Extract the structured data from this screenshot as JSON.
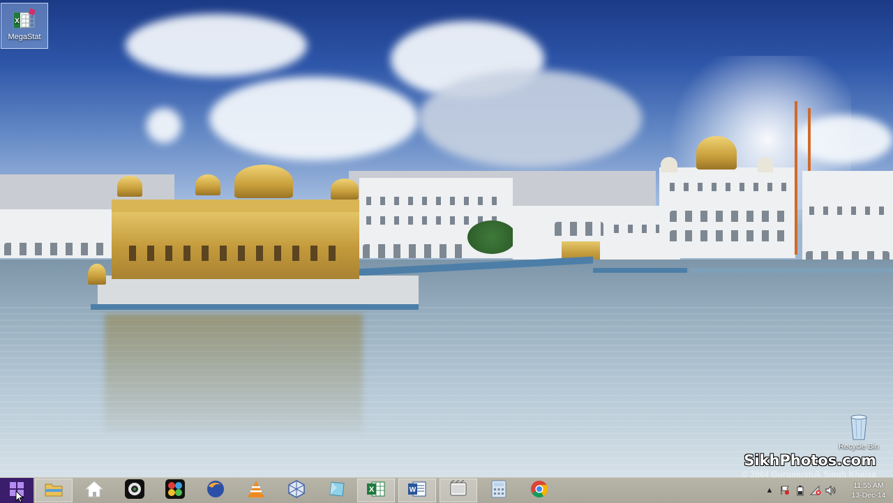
{
  "desktop": {
    "icons": [
      {
        "label": "MegaStat",
        "icon": "excel-addin-icon"
      },
      {
        "label": "Recycle Bin",
        "icon": "recycle-bin-icon"
      }
    ]
  },
  "wallpaper": {
    "watermark_main": "SikhPhotos.com",
    "watermark_sub": "© 2004 Gurumustuk Singh Khalsa"
  },
  "taskbar": {
    "start_icon": "windows-start-icon",
    "pinned": [
      {
        "icon": "file-explorer-icon",
        "active": true
      },
      {
        "icon": "home-icon",
        "active": false
      },
      {
        "icon": "webcam-icon",
        "active": false
      },
      {
        "icon": "colorful-app-icon",
        "active": false
      },
      {
        "icon": "firefox-icon",
        "active": false
      },
      {
        "icon": "vlc-icon",
        "active": false
      },
      {
        "icon": "virtualbox-icon",
        "active": false
      },
      {
        "icon": "glass-app-icon",
        "active": false
      },
      {
        "icon": "excel-icon",
        "active": true
      },
      {
        "icon": "word-icon",
        "active": true
      },
      {
        "icon": "video-app-icon",
        "active": true
      },
      {
        "icon": "calculator-icon",
        "active": false
      },
      {
        "icon": "chrome-icon",
        "active": false
      }
    ],
    "tray": {
      "icons": [
        "show-hidden-icons-chevron",
        "flag-icon",
        "battery-icon",
        "network-error-icon",
        "volume-icon"
      ],
      "time": "11:55 AM",
      "date": "13-Dec-14"
    }
  },
  "colors": {
    "start_bg": "#3a1d6b",
    "taskbar_bg": "#aca99d",
    "accent_gold": "#d4ab48"
  }
}
